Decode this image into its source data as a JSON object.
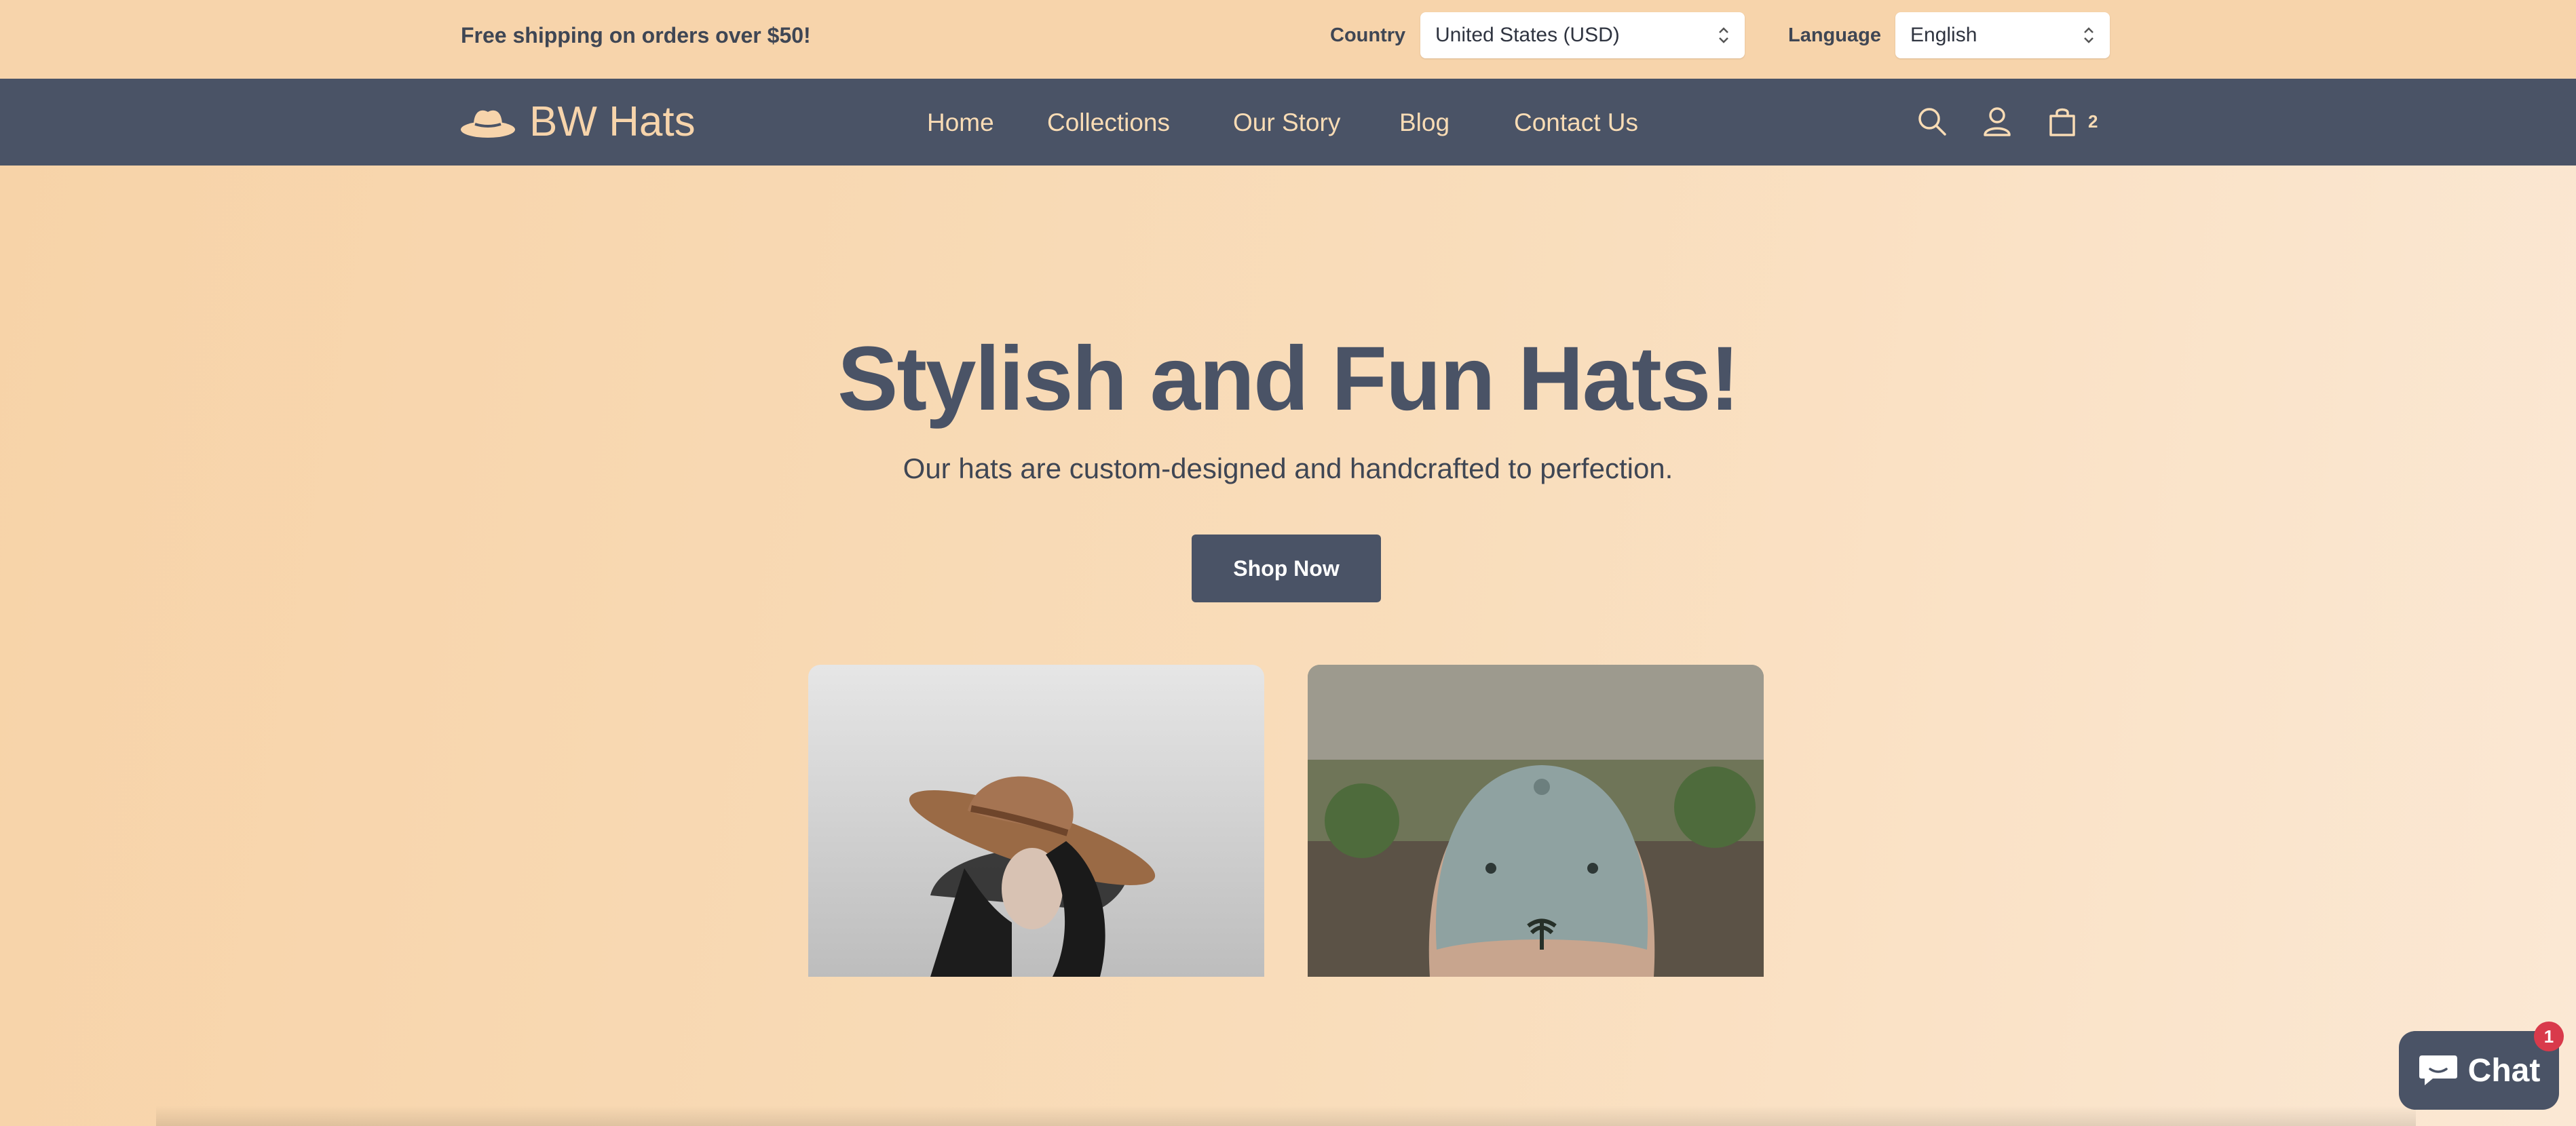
{
  "announcement": {
    "text": "Free shipping on orders over $50!",
    "country_label": "Country",
    "country_value": "United States (USD)",
    "language_label": "Language",
    "language_value": "English"
  },
  "header": {
    "logo_text": "BW Hats",
    "nav": [
      "Home",
      "Collections",
      "Our Story",
      "Blog",
      "Contact Us"
    ],
    "cart_count": "2",
    "icons": [
      "hat-icon",
      "search-icon",
      "user-icon",
      "cart-icon"
    ]
  },
  "hero": {
    "title": "Stylish and Fun Hats!",
    "subtitle": "Our hats are custom-designed and handcrafted to perfection.",
    "cta": "Shop Now"
  },
  "chat": {
    "label": "Chat",
    "badge": "1"
  },
  "colors": {
    "accent": "#4a5366",
    "background": "#f8d7ad",
    "logo": "#f7d4ab",
    "badge": "#d93a4b"
  }
}
